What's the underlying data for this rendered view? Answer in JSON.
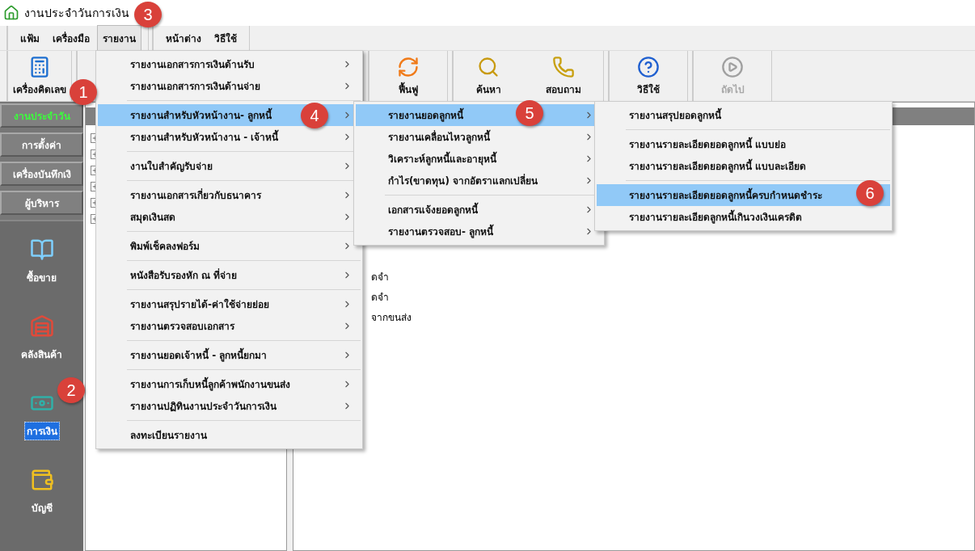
{
  "window": {
    "title": "งานประจำวันการเงิน"
  },
  "menubar": [
    {
      "items": [
        {
          "label": "แฟ้ม",
          "selected": false
        },
        {
          "label": "เครื่องมือ",
          "selected": false
        },
        {
          "label": "รายงาน",
          "selected": true
        }
      ]
    },
    {
      "items": [
        {
          "label": "หน้าต่าง",
          "selected": false
        },
        {
          "label": "วิธีใช้",
          "selected": false
        }
      ]
    }
  ],
  "toolbar": [
    {
      "kind": "group",
      "buttons": [
        {
          "kind": "calculator",
          "label": "เครื่องคิดเลข",
          "disabled": false
        }
      ]
    },
    {
      "kind": "gap"
    },
    {
      "kind": "group",
      "buttons": [
        {
          "kind": "refresh",
          "label": "ฟื้นฟู",
          "disabled": false
        }
      ]
    },
    {
      "kind": "group",
      "buttons": [
        {
          "kind": "search",
          "label": "ค้นหา",
          "disabled": false
        },
        {
          "kind": "phone",
          "label": "สอบถาม",
          "disabled": false
        }
      ]
    },
    {
      "kind": "group",
      "buttons": [
        {
          "kind": "help",
          "label": "วิธีใช้",
          "disabled": false
        }
      ]
    },
    {
      "kind": "group",
      "buttons": [
        {
          "kind": "next",
          "label": "ถัดไป",
          "disabled": true
        }
      ]
    }
  ],
  "sidebar": {
    "tabs": [
      {
        "label": "งานประจำวัน",
        "selected": true
      },
      {
        "label": "การตั้งค่า",
        "selected": false
      },
      {
        "label": "เครื่องบันทึกเงิ",
        "selected": false
      },
      {
        "label": "ผู้บริหาร",
        "selected": false
      }
    ],
    "modules": [
      {
        "kind": "book",
        "label": "ซื้อขาย",
        "selected": false
      },
      {
        "kind": "warehouse",
        "label": "คลังสินค้า",
        "selected": false
      },
      {
        "kind": "money",
        "label": "การเงิน",
        "selected": true
      },
      {
        "kind": "wallet",
        "label": "บัญชี",
        "selected": false
      }
    ]
  },
  "tree": {
    "items": [
      {
        "expanded": false
      },
      {
        "expanded": false
      },
      {
        "expanded": false
      },
      {
        "expanded": false
      },
      {
        "expanded": false
      },
      {
        "expanded": false
      }
    ]
  },
  "list": {
    "rows": [
      "ดจำ",
      "ดจำ",
      "จากขนส่ง"
    ]
  },
  "menus": [
    {
      "items": [
        {
          "kind": "item",
          "label": "รายงานเอกสารการเงินด้านรับ",
          "selected": false,
          "submenu": true
        },
        {
          "kind": "item",
          "label": "รายงานเอกสารการเงินด้านจ่าย",
          "selected": false,
          "submenu": true
        },
        {
          "kind": "separator"
        },
        {
          "kind": "item",
          "label": "รายงานสำหรับหัวหน้างาน- ลูกหนี้",
          "selected": true,
          "submenu": true
        },
        {
          "kind": "item",
          "label": "รายงานสำหรับหัวหน้างาน - เจ้าหนี้",
          "selected": false,
          "submenu": true
        },
        {
          "kind": "separator"
        },
        {
          "kind": "item",
          "label": "งานใบสำคัญรับจ่าย",
          "selected": false,
          "submenu": true
        },
        {
          "kind": "separator"
        },
        {
          "kind": "item",
          "label": "รายงานเอกสารเกี่ยวกับธนาคาร",
          "selected": false,
          "submenu": true
        },
        {
          "kind": "item",
          "label": "สมุดเงินสด",
          "selected": false,
          "submenu": true
        },
        {
          "kind": "separator"
        },
        {
          "kind": "item",
          "label": "พิมพ์เช็คลงฟอร์ม",
          "selected": false,
          "submenu": true
        },
        {
          "kind": "separator"
        },
        {
          "kind": "item",
          "label": "หนังสือรับรองหัก ณ ที่จ่าย",
          "selected": false,
          "submenu": true
        },
        {
          "kind": "separator"
        },
        {
          "kind": "item",
          "label": "รายงานสรุปรายได้-ค่าใช้จ่ายย่อย",
          "selected": false,
          "submenu": true
        },
        {
          "kind": "item",
          "label": "รายงานตรวจสอบเอกสาร",
          "selected": false,
          "submenu": true
        },
        {
          "kind": "separator"
        },
        {
          "kind": "item",
          "label": "รายงานยอดเจ้าหนี้  - ลูกหนี้ยกมา",
          "selected": false,
          "submenu": true
        },
        {
          "kind": "separator"
        },
        {
          "kind": "item",
          "label": "รายงานการเก็บหนี้ลูกค้าพนักงานขนส่ง",
          "selected": false,
          "submenu": true
        },
        {
          "kind": "item",
          "label": "รายงานปฏิทินงานประจำวันการเงิน",
          "selected": false,
          "submenu": true
        },
        {
          "kind": "separator"
        },
        {
          "kind": "item",
          "label": "ลงทะเบียนรายงาน",
          "selected": false,
          "submenu": false
        }
      ]
    },
    {
      "items": [
        {
          "kind": "item",
          "label": "รายงานยอดลูกหนี้",
          "selected": true,
          "submenu": true
        },
        {
          "kind": "item",
          "label": "รายงานเคลื่อนไหวลูกหนี้",
          "selected": false,
          "submenu": true
        },
        {
          "kind": "item",
          "label": "วิเคราะห์ลูกหนี้และอายุหนี้",
          "selected": false,
          "submenu": true
        },
        {
          "kind": "item",
          "label": "กำไร(ขาดทุน) จากอัตราแลกเปลี่ยน",
          "selected": false,
          "submenu": true
        },
        {
          "kind": "separator"
        },
        {
          "kind": "item",
          "label": "เอกสารแจ้งยอดลูกหนี้",
          "selected": false,
          "submenu": true
        },
        {
          "kind": "item",
          "label": "รายงานตรวจสอบ- ลูกหนี้",
          "selected": false,
          "submenu": true
        }
      ]
    },
    {
      "items": [
        {
          "kind": "item",
          "label": "รายงานสรุปยอดลูกหนี้",
          "selected": false,
          "submenu": false
        },
        {
          "kind": "separator"
        },
        {
          "kind": "item",
          "label": "รายงานรายละเอียดยอดลูกหนี้ แบบย่อ",
          "selected": false,
          "submenu": false
        },
        {
          "kind": "item",
          "label": "รายงานรายละเอียดยอดลูกหนี้ แบบละเอียด",
          "selected": false,
          "submenu": false
        },
        {
          "kind": "separator"
        },
        {
          "kind": "item",
          "label": "รายงานรายละเอียดยอดลูกหนี้ครบกำหนดชำระ",
          "selected": true,
          "submenu": false
        },
        {
          "kind": "item",
          "label": "รายงานรายละเอียดลูกหนี้เกินวงเงินเครดิต",
          "selected": false,
          "submenu": false
        }
      ]
    }
  ],
  "annotations": [
    {
      "label": "1"
    },
    {
      "label": "2"
    },
    {
      "label": "3"
    },
    {
      "label": "4"
    },
    {
      "label": "5"
    },
    {
      "label": "6"
    }
  ]
}
